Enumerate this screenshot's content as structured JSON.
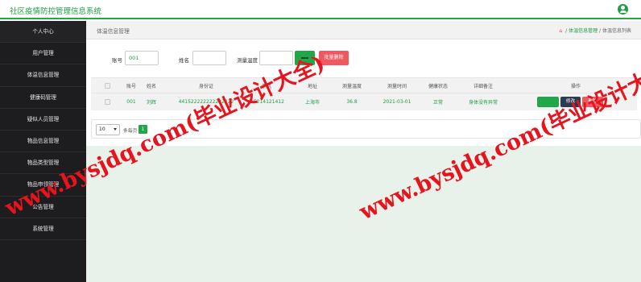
{
  "app": {
    "title": "社区疫情防控管理信息系统"
  },
  "sidebar": {
    "items": [
      {
        "label": "个人中心"
      },
      {
        "label": "用户管理"
      },
      {
        "label": "体温信息管理"
      },
      {
        "label": "健康码管理"
      },
      {
        "label": "疑似人员管理"
      },
      {
        "label": "物品信息管理"
      },
      {
        "label": "物品类型管理"
      },
      {
        "label": "物品申领管理"
      },
      {
        "label": "公告管理"
      },
      {
        "label": "系统管理"
      }
    ]
  },
  "breadcrumb": {
    "title": "体温信息管理",
    "path": [
      "体温信息管理",
      "体温信息列表"
    ],
    "separator": "/"
  },
  "search": {
    "account_label": "账号",
    "account_value": "001",
    "name_label": "姓名",
    "name_value": "",
    "temp_label": "测量温度",
    "temp_value": "",
    "batch_delete_label": "批量删除"
  },
  "table": {
    "headers": [
      "账号",
      "姓名",
      "身份证",
      "手机",
      "地址",
      "测量温度",
      "测量时间",
      "健康状态",
      "详细备注",
      "操作"
    ],
    "rows": [
      {
        "account": "001",
        "name": "刘辉",
        "id_card": "441522222222222222",
        "phone": "15214121412",
        "address": "上海市",
        "temperature": "36.8",
        "time": "2021-03-01",
        "health": "正常",
        "remark": "身体没有异常"
      }
    ],
    "actions": {
      "edit": "修改",
      "delete": "删除"
    }
  },
  "pagination": {
    "page_size": "10",
    "per_page_label": "条每页",
    "current_page": "1"
  },
  "watermark": {
    "text": "www.bysjdq.com(毕业设计大全)"
  },
  "colors": {
    "accent": "#22a64a",
    "danger": "#f0575e",
    "sidebar": "#1d1d1f",
    "content_bg": "#e8f1ea",
    "watermark": "#e6141d"
  }
}
